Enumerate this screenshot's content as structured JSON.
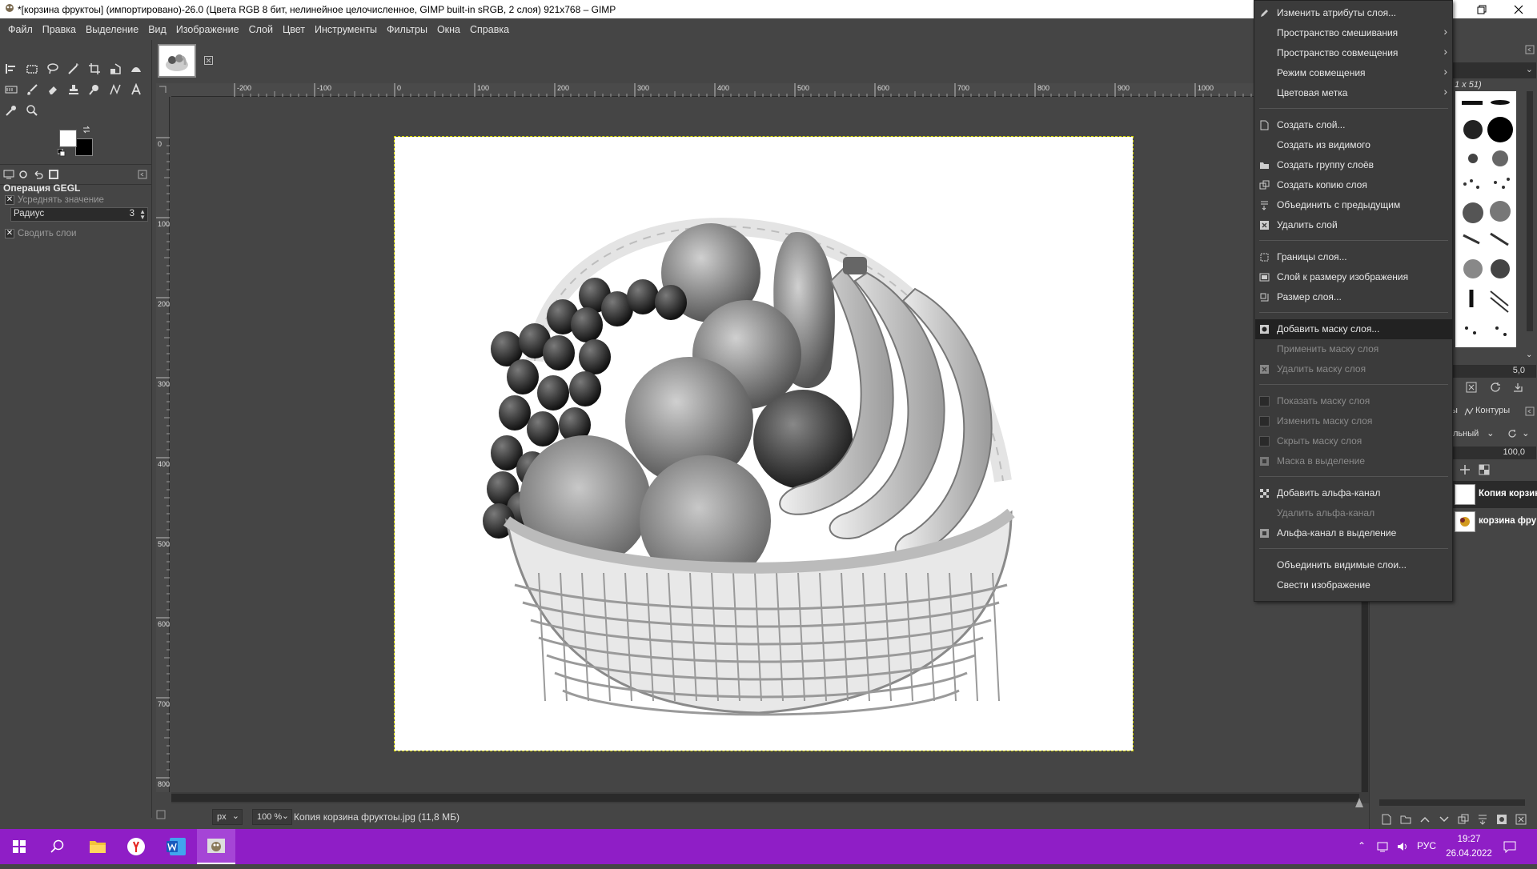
{
  "window": {
    "title": "*[корзина фруктоы] (импортировано)-26.0 (Цвета RGB 8 бит, нелинейное целочисленное, GIMP built-in sRGB, 2 слоя) 921x768 – GIMP"
  },
  "menubar": {
    "items": [
      "Файл",
      "Правка",
      "Выделение",
      "Вид",
      "Изображение",
      "Слой",
      "Цвет",
      "Инструменты",
      "Фильтры",
      "Окна",
      "Справка"
    ]
  },
  "tool_options": {
    "title": "Операция GEGL",
    "average_label": "Усреднять значение",
    "radius_label": "Радиус",
    "radius_value": "3",
    "merge_label": "Сводить слои"
  },
  "hruler": {
    "labels": [
      "-200",
      "-100",
      "0",
      "100",
      "200",
      "300",
      "400",
      "500",
      "600",
      "700",
      "800",
      "900",
      "1000"
    ]
  },
  "vruler": {
    "labels": [
      "0",
      "100",
      "200",
      "300",
      "400",
      "500",
      "600",
      "700",
      "800"
    ]
  },
  "statusbar": {
    "unit": "px",
    "zoom": "100 %",
    "text": "Копия корзина фруктоы.jpg (11,8 МБ)"
  },
  "right_dock": {
    "brush_title": "1 x 51)",
    "brush_spacing": "5,0",
    "tab_paths": "Контуры",
    "tab_channels_partial": "ы",
    "mode": "льный",
    "opacity": "100,0",
    "layers": [
      {
        "name": "Копия корзин",
        "selected": true
      },
      {
        "name": "корзина фру",
        "selected": false
      }
    ]
  },
  "context_menu": {
    "items": [
      {
        "label": "Изменить атрибуты слоя...",
        "icon": "edit-icon",
        "disabled": false,
        "submenu": false
      },
      {
        "label": "Пространство смешивания",
        "disabled": false,
        "submenu": true
      },
      {
        "label": "Пространство совмещения",
        "disabled": false,
        "submenu": true
      },
      {
        "label": "Режим совмещения",
        "disabled": false,
        "submenu": true
      },
      {
        "label": "Цветовая метка",
        "disabled": false,
        "submenu": true
      },
      {
        "label": "Создать слой...",
        "icon": "new-layer-icon",
        "disabled": false
      },
      {
        "label": "Создать из видимого",
        "disabled": false
      },
      {
        "label": "Создать группу слоёв",
        "icon": "folder-icon",
        "disabled": false
      },
      {
        "label": "Создать копию слоя",
        "icon": "duplicate-icon",
        "disabled": false
      },
      {
        "label": "Объединить с предыдущим",
        "icon": "merge-down-icon",
        "disabled": false
      },
      {
        "label": "Удалить слой",
        "icon": "delete-icon",
        "disabled": false
      },
      {
        "label": "Границы слоя...",
        "icon": "boundary-icon",
        "disabled": false
      },
      {
        "label": "Слой к размеру изображения",
        "icon": "fit-icon",
        "disabled": false
      },
      {
        "label": "Размер слоя...",
        "icon": "resize-icon",
        "disabled": false
      },
      {
        "label": "Добавить маску слоя...",
        "icon": "mask-icon",
        "disabled": false,
        "highlighted": true
      },
      {
        "label": "Применить маску слоя",
        "disabled": true
      },
      {
        "label": "Удалить маску слоя",
        "icon": "delete-icon",
        "disabled": true
      },
      {
        "label": "Показать маску слоя",
        "checkbox": true,
        "disabled": true
      },
      {
        "label": "Изменить маску слоя",
        "checkbox": true,
        "disabled": true
      },
      {
        "label": "Скрыть маску слоя",
        "checkbox": true,
        "disabled": true
      },
      {
        "label": "Маска в выделение",
        "icon": "selection-icon",
        "disabled": true
      },
      {
        "label": "Добавить альфа-канал",
        "icon": "alpha-icon",
        "disabled": false
      },
      {
        "label": "Удалить альфа-канал",
        "disabled": true
      },
      {
        "label": "Альфа-канал в выделение",
        "icon": "selection-icon",
        "disabled": false
      },
      {
        "label": "Объединить видимые слои...",
        "disabled": false
      },
      {
        "label": "Свести изображение",
        "disabled": false
      }
    ]
  },
  "taskbar": {
    "lang": "РУС",
    "time": "19:27",
    "date": "26.04.2022"
  },
  "colors": {
    "taskbar": "#8f1ec6",
    "panel": "#454545",
    "menu": "#3b3b3b",
    "selection_outline": "#d8d800"
  }
}
